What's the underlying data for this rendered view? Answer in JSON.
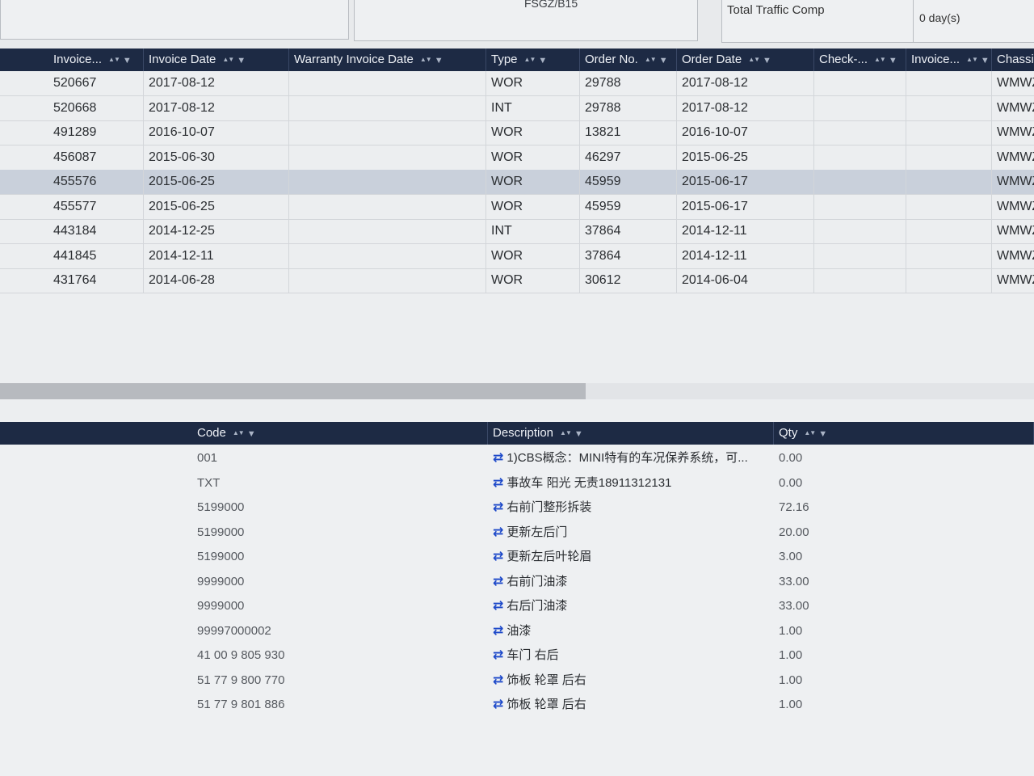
{
  "header": {
    "code_value": "FSGZ/B15",
    "total_traffic_comp_label": "Total Traffic Comp",
    "total_traffic_comp_value": "0 day(s)"
  },
  "invoice_table": {
    "columns": [
      "Invoice...",
      "Invoice Date",
      "Warranty Invoice Date",
      "Type",
      "Order No.",
      "Order Date",
      "Check-...",
      "Invoice...",
      "Chassi..."
    ],
    "rows": [
      {
        "invoice": "520667",
        "invoice_date": "2017-08-12",
        "warranty_date": "",
        "type": "WOR",
        "order_no": "29788",
        "order_date": "2017-08-12",
        "check": "",
        "invoice2": "",
        "chassis": "WMWZ"
      },
      {
        "invoice": "520668",
        "invoice_date": "2017-08-12",
        "warranty_date": "",
        "type": "INT",
        "order_no": "29788",
        "order_date": "2017-08-12",
        "check": "",
        "invoice2": "",
        "chassis": "WMWZ"
      },
      {
        "invoice": "491289",
        "invoice_date": "2016-10-07",
        "warranty_date": "",
        "type": "WOR",
        "order_no": "13821",
        "order_date": "2016-10-07",
        "check": "",
        "invoice2": "",
        "chassis": "WMWZ"
      },
      {
        "invoice": "456087",
        "invoice_date": "2015-06-30",
        "warranty_date": "",
        "type": "WOR",
        "order_no": "46297",
        "order_date": "2015-06-25",
        "check": "",
        "invoice2": "",
        "chassis": "WMWZ"
      },
      {
        "invoice": "455576",
        "invoice_date": "2015-06-25",
        "warranty_date": "",
        "type": "WOR",
        "order_no": "45959",
        "order_date": "2015-06-17",
        "check": "",
        "invoice2": "",
        "chassis": "WMWZ"
      },
      {
        "invoice": "455577",
        "invoice_date": "2015-06-25",
        "warranty_date": "",
        "type": "WOR",
        "order_no": "45959",
        "order_date": "2015-06-17",
        "check": "",
        "invoice2": "",
        "chassis": "WMWZ"
      },
      {
        "invoice": "443184",
        "invoice_date": "2014-12-25",
        "warranty_date": "",
        "type": "INT",
        "order_no": "37864",
        "order_date": "2014-12-11",
        "check": "",
        "invoice2": "",
        "chassis": "WMWZ"
      },
      {
        "invoice": "441845",
        "invoice_date": "2014-12-11",
        "warranty_date": "",
        "type": "WOR",
        "order_no": "37864",
        "order_date": "2014-12-11",
        "check": "",
        "invoice2": "",
        "chassis": "WMWZ"
      },
      {
        "invoice": "431764",
        "invoice_date": "2014-06-28",
        "warranty_date": "",
        "type": "WOR",
        "order_no": "30612",
        "order_date": "2014-06-04",
        "check": "",
        "invoice2": "",
        "chassis": "WMWZ"
      }
    ],
    "selected_row": 4
  },
  "detail_table": {
    "columns": [
      "Code",
      "Description",
      "Qty"
    ],
    "rows": [
      {
        "code": "001",
        "description": "1)CBS概念：MINI特有的车况保养系统，可...",
        "qty": "0.00"
      },
      {
        "code": "TXT",
        "description": "事故车 阳光 无责18911312131",
        "qty": "0.00"
      },
      {
        "code": "5199000",
        "description": "右前门整形拆装",
        "qty": "72.16"
      },
      {
        "code": "5199000",
        "description": "更新左后门",
        "qty": "20.00"
      },
      {
        "code": "5199000",
        "description": "更新左后叶轮眉",
        "qty": "3.00"
      },
      {
        "code": "9999000",
        "description": "右前门油漆",
        "qty": "33.00"
      },
      {
        "code": "9999000",
        "description": "右后门油漆",
        "qty": "33.00"
      },
      {
        "code": "99997000002",
        "description": "油漆",
        "qty": "1.00"
      },
      {
        "code": "41 00 9 805 930",
        "description": "车门 右后",
        "qty": "1.00"
      },
      {
        "code": "51 77 9 800 770",
        "description": "饰板 轮罩 后右",
        "qty": "1.00"
      },
      {
        "code": "51 77 9 801 886",
        "description": "饰板 轮罩 后右",
        "qty": "1.00"
      }
    ]
  },
  "icons": {
    "sort": "sort-updown-icon",
    "filter": "funnel-filter-icon",
    "row_action": "swap-arrows-icon"
  },
  "colors": {
    "header_bg": "#1d2a44",
    "selected_row": "#c9d0db",
    "row_action_icon": "#1d49c9"
  }
}
